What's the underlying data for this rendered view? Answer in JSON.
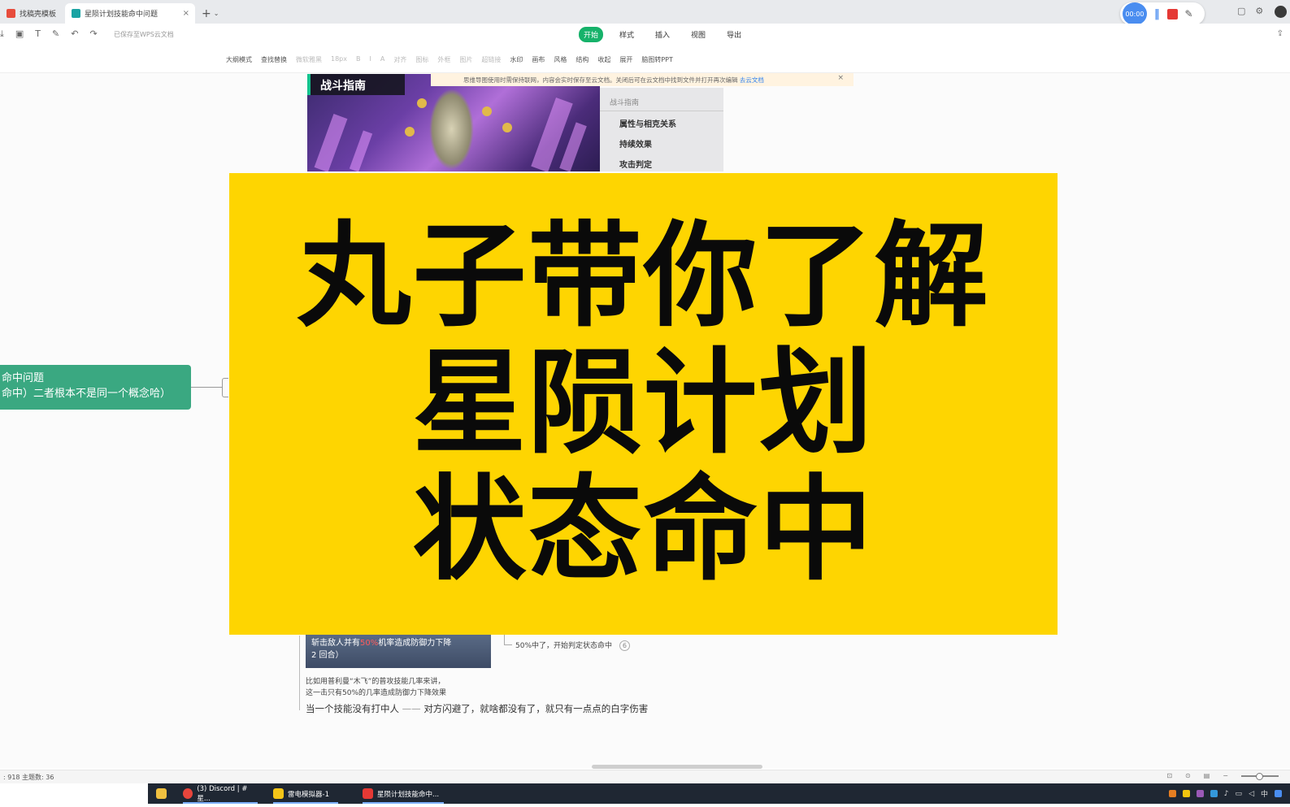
{
  "browser": {
    "tabs": [
      {
        "label": "找稿壳模板"
      },
      {
        "label": "星陨计划技能命中问题"
      }
    ],
    "new_tab": "+"
  },
  "recorder": {
    "timer": "00:00"
  },
  "doc": {
    "saved_text": "已保存至WPS云文档",
    "menus": [
      "开始",
      "样式",
      "插入",
      "视图",
      "导出"
    ],
    "tools": [
      "大纲模式",
      "查找替换",
      "微软雅黑",
      "18px",
      "B",
      "I",
      "A",
      "对齐",
      "图标",
      "外框",
      "图片",
      "超链接",
      "水印",
      "画布",
      "风格",
      "结构",
      "收起",
      "展开",
      "脑图转PPT"
    ],
    "notice": "思维导图使用时需保持联网，内容会实时保存至云文档。关闭后可在云文档中找到文件并打开再次编辑",
    "notice_link": "去云文档"
  },
  "game_card": {
    "title": "战斗指南",
    "side_head": "战斗指南",
    "side_items": [
      "属性与相克关系",
      "持续效果",
      "攻击判定"
    ]
  },
  "mindmap": {
    "node_line1": "命中问题",
    "node_line2": "命中）二者根本不是同一个概念哈）",
    "thumb_text_a": "斩击敌人并有",
    "thumb_text_hl": "50%",
    "thumb_text_b": "机率造成防御力下降",
    "thumb_text_c": "2 回合）",
    "caption_1": "比如用普利曼“木飞”的普攻技能几率来讲，",
    "caption_2": "这一击只有50%的几率造成防御力下降效果",
    "branch": "50%中了，开始判定状态命中",
    "branch_badge": "6",
    "main_a": "当一个技能没有打中人",
    "main_sep": "——",
    "main_b": "对方闪避了，就啥都没有了，就只有一点点的白字伤害"
  },
  "banner": {
    "line1": "丸子带你了解",
    "line2": "星陨计划",
    "line3": "状态命中",
    "color": "#fed501"
  },
  "status": {
    "text": ": 918    主题数: 36"
  },
  "taskbar": {
    "apps": [
      {
        "label": "(3) Discord | #星..."
      },
      {
        "label": "雷电模拟器-1"
      },
      {
        "label": "星陨计划技能命中..."
      }
    ],
    "ime": "中"
  }
}
